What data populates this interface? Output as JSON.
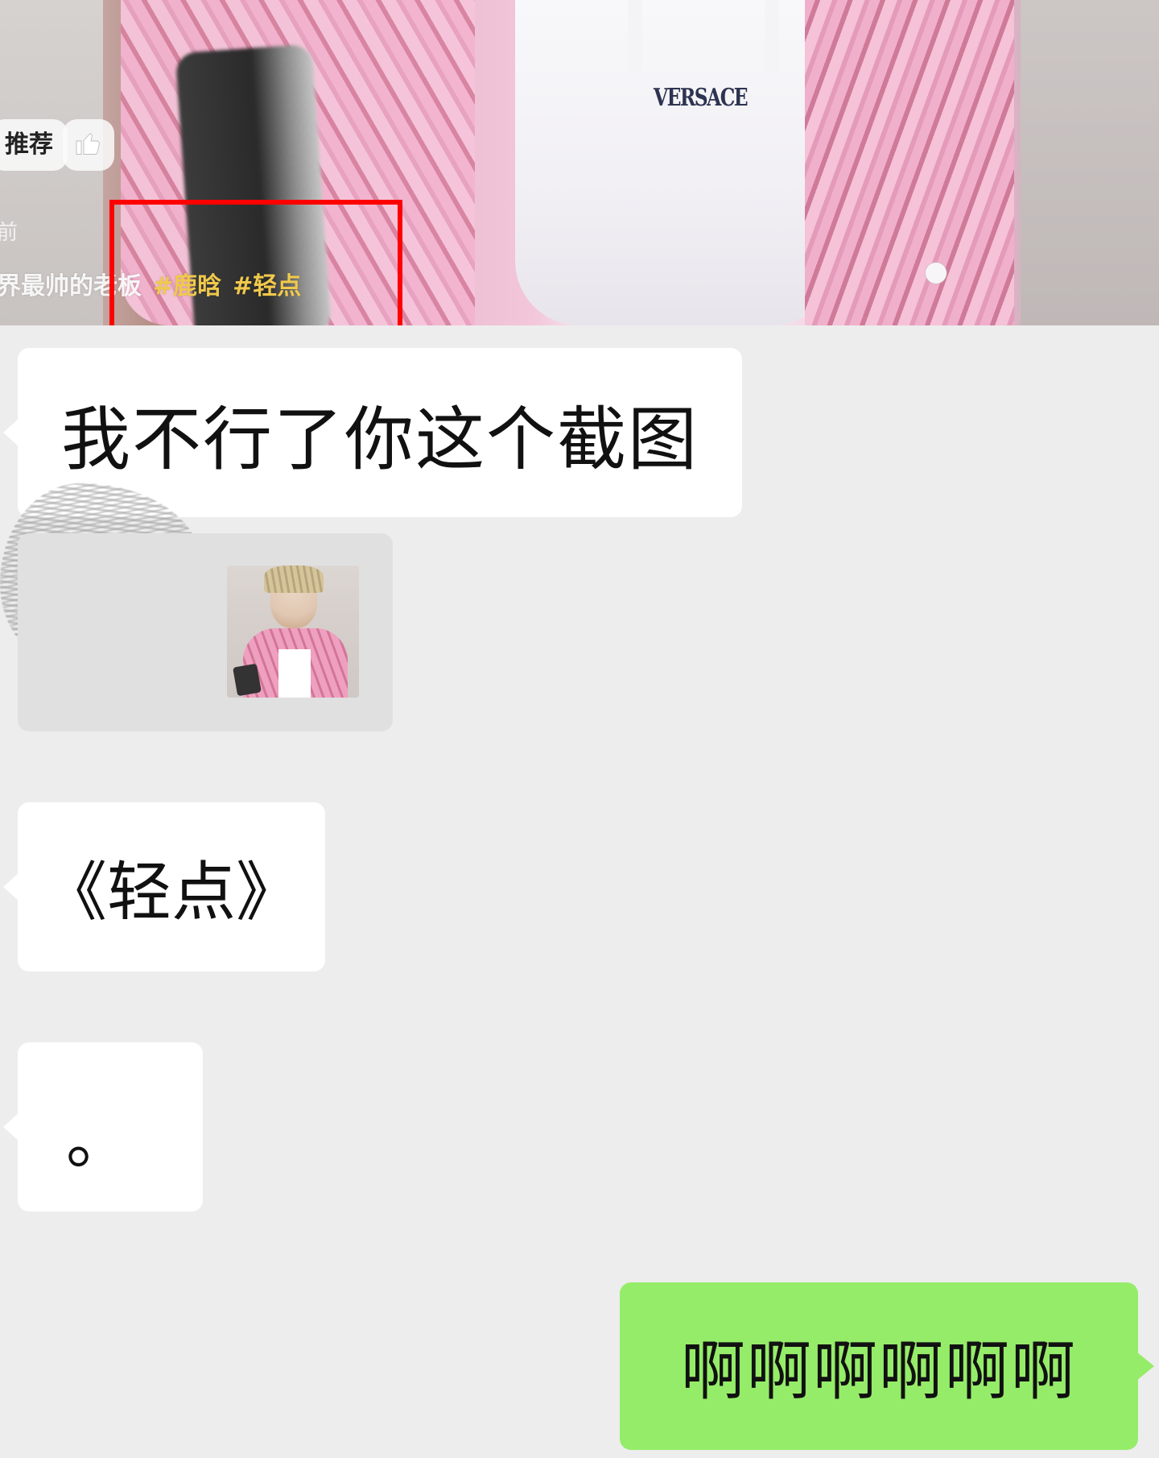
{
  "video": {
    "brand_text": "VERSACE",
    "recommend_label": "推荐",
    "time_text": "前",
    "caption_text": "界最帅的老板",
    "tags": [
      "#鹿晗",
      "#轻点"
    ],
    "highlight_color": "#ff0000",
    "like_icon": "thumbs-up-icon"
  },
  "chat": {
    "messages": [
      {
        "side": "incoming",
        "type": "text",
        "text": "我不行了你这个截图"
      },
      {
        "side": "incoming",
        "type": "image",
        "description": ""
      },
      {
        "side": "incoming",
        "type": "text",
        "text": "《轻点》"
      },
      {
        "side": "incoming",
        "type": "text",
        "text": "。"
      },
      {
        "side": "outgoing",
        "type": "text",
        "text": "啊啊啊啊啊啊"
      }
    ],
    "colors": {
      "background": "#ededed",
      "incoming_bubble": "#ffffff",
      "outgoing_bubble": "#95ec69"
    }
  }
}
